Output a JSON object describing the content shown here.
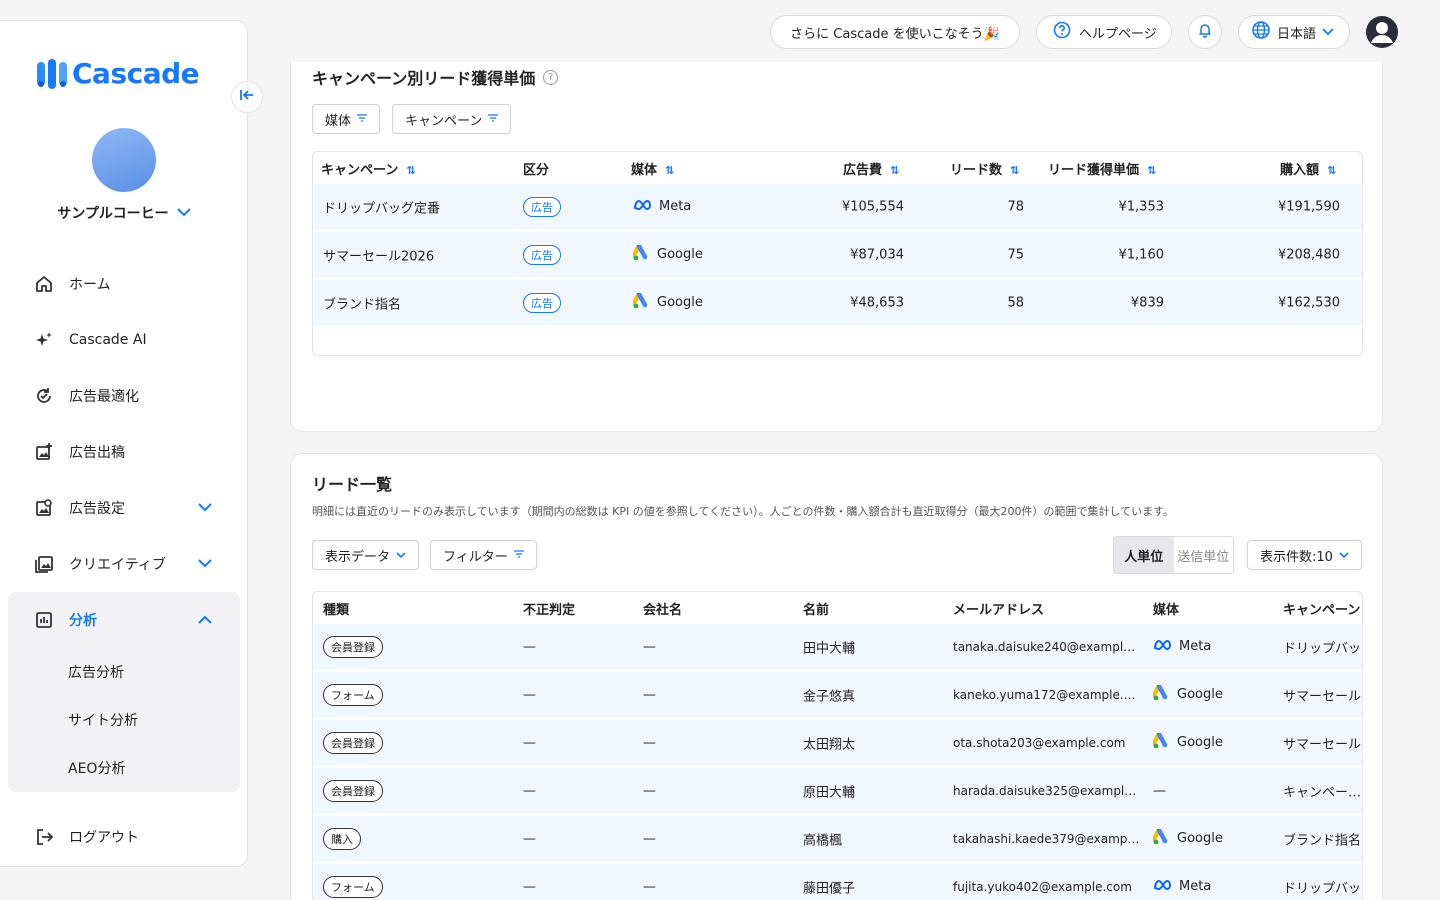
{
  "brand": {
    "name": "Cascade",
    "accent": "#1677ff"
  },
  "account": {
    "name": "サンプルコーヒー"
  },
  "topbar": {
    "tip_label": "さらに Cascade を使いこなそう🎉",
    "help_label": "ヘルプページ",
    "language_label": "日本語"
  },
  "nav": {
    "items": [
      {
        "label": "ホーム",
        "icon": "home-icon"
      },
      {
        "label": "Cascade AI",
        "icon": "sparkle-icon"
      },
      {
        "label": "広告最適化",
        "icon": "optimize-icon"
      },
      {
        "label": "広告出稿",
        "icon": "image-add-icon"
      },
      {
        "label": "広告設定",
        "icon": "settings-image-icon"
      },
      {
        "label": "クリエイティブ",
        "icon": "gallery-icon"
      }
    ],
    "analysis": {
      "label": "分析",
      "sub": [
        "広告分析",
        "サイト分析",
        "AEO分析"
      ]
    },
    "logout": "ログアウト"
  },
  "campaign_cpl": {
    "title": "キャンペーン別リード獲得単価",
    "filters": [
      "媒体",
      "キャンペーン"
    ],
    "columns": [
      "キャンペーン",
      "区分",
      "媒体",
      "広告費",
      "リード数",
      "リード獲得単価",
      "購入額"
    ],
    "rows": [
      {
        "campaign": "ドリップバッグ定番",
        "type": "広告",
        "media": "Meta",
        "spend": "¥105,554",
        "leads": "78",
        "cpl": "¥1,353",
        "purchase": "¥191,590"
      },
      {
        "campaign": "サマーセール2026",
        "type": "広告",
        "media": "Google",
        "spend": "¥87,034",
        "leads": "75",
        "cpl": "¥1,160",
        "purchase": "¥208,480"
      },
      {
        "campaign": "ブランド指名",
        "type": "広告",
        "media": "Google",
        "spend": "¥48,653",
        "leads": "58",
        "cpl": "¥839",
        "purchase": "¥162,530"
      }
    ]
  },
  "leads": {
    "title": "リード一覧",
    "description": "明細には直近のリードのみ表示しています（期間内の総数は KPI の値を参照してください）。人ごとの件数・購入額合計も直近取得分（最大200件）の範囲で集計しています。",
    "display_data_label": "表示データ",
    "filter_label": "フィルター",
    "segment": [
      "人単位",
      "送信単位"
    ],
    "page_size_label": "表示件数:10",
    "columns": [
      "種類",
      "不正判定",
      "会社名",
      "名前",
      "メールアドレス",
      "媒体",
      "キャンペーン"
    ],
    "rows": [
      {
        "kind": "会員登録",
        "fraud": "—",
        "company": "—",
        "name": "田中大輔",
        "email": "tanaka.daisuke240@exampl…",
        "media": "Meta",
        "campaign": "ドリップバッ…"
      },
      {
        "kind": "フォーム",
        "fraud": "—",
        "company": "—",
        "name": "金子悠真",
        "email": "kaneko.yuma172@example.…",
        "media": "Google",
        "campaign": "サマーセール…"
      },
      {
        "kind": "会員登録",
        "fraud": "—",
        "company": "—",
        "name": "太田翔太",
        "email": "ota.shota203@example.com",
        "media": "Google",
        "campaign": "サマーセール…"
      },
      {
        "kind": "会員登録",
        "fraud": "—",
        "company": "—",
        "name": "原田大輔",
        "email": "harada.daisuke325@exampl…",
        "media": "—",
        "campaign": "キャンペー…"
      },
      {
        "kind": "購入",
        "fraud": "—",
        "company": "—",
        "name": "高橋楓",
        "email": "takahashi.kaede379@examp…",
        "media": "Google",
        "campaign": "ブランド指名"
      },
      {
        "kind": "フォーム",
        "fraud": "—",
        "company": "—",
        "name": "藤田優子",
        "email": "fujita.yuko402@example.com",
        "media": "Meta",
        "campaign": "ドリップバッ…"
      }
    ]
  }
}
